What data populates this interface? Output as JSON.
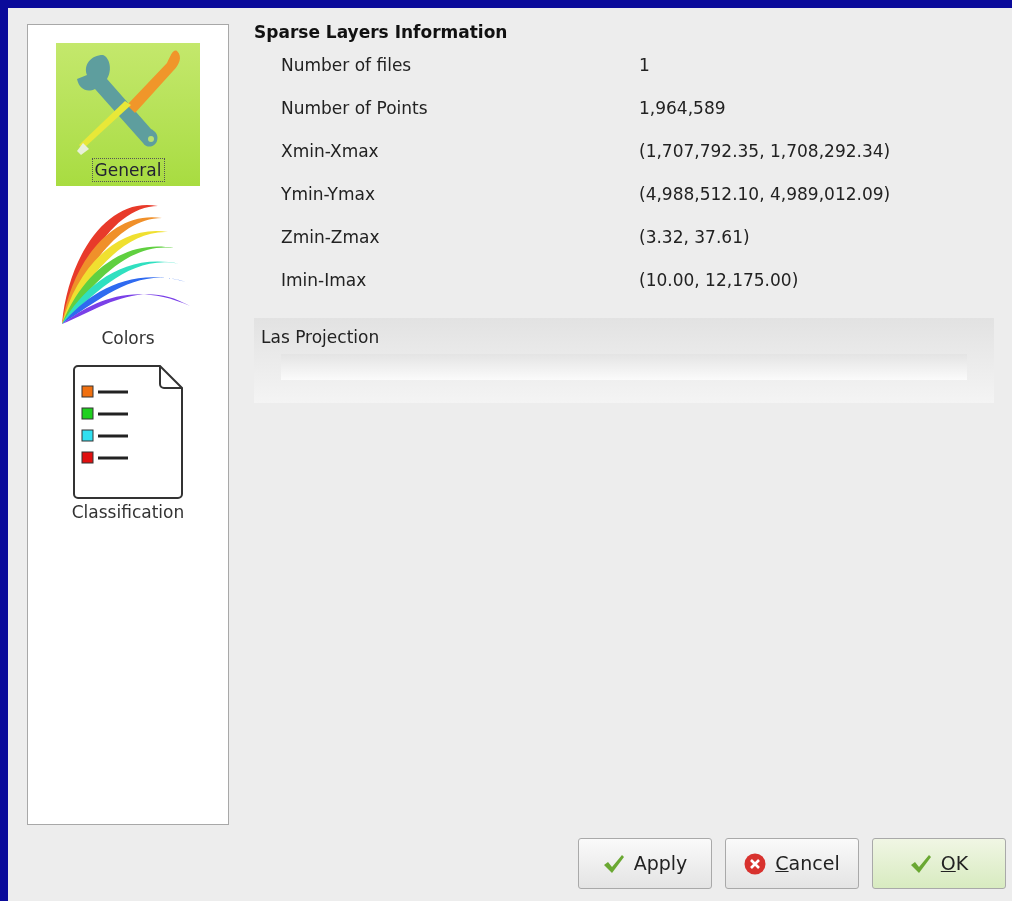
{
  "sidebar": {
    "items": [
      {
        "label": "General",
        "kind": "tools",
        "selected": true
      },
      {
        "label": "Colors",
        "kind": "rainbow",
        "selected": false
      },
      {
        "label": "Classification",
        "kind": "document",
        "selected": false
      }
    ]
  },
  "info": {
    "title": "Sparse Layers Information",
    "rows": [
      {
        "label": "Number of files",
        "value": "1"
      },
      {
        "label": "Number of Points",
        "value": "1,964,589"
      },
      {
        "label": "Xmin-Xmax",
        "value": "(1,707,792.35, 1,708,292.34)"
      },
      {
        "label": "Ymin-Ymax",
        "value": "(4,988,512.10, 4,989,012.09)"
      },
      {
        "label": "Zmin-Zmax",
        "value": "(3.32, 37.61)"
      },
      {
        "label": "Imin-Imax",
        "value": "(10.00, 12,175.00)"
      }
    ]
  },
  "projection": {
    "title": "Las Projection"
  },
  "buttons": [
    {
      "label": "Apply",
      "kind": "check",
      "default": false,
      "underline_first": false
    },
    {
      "label": "Cancel",
      "kind": "cancel",
      "default": false,
      "underline_first": true
    },
    {
      "label": "OK",
      "kind": "check",
      "default": true,
      "underline_first": true
    }
  ]
}
